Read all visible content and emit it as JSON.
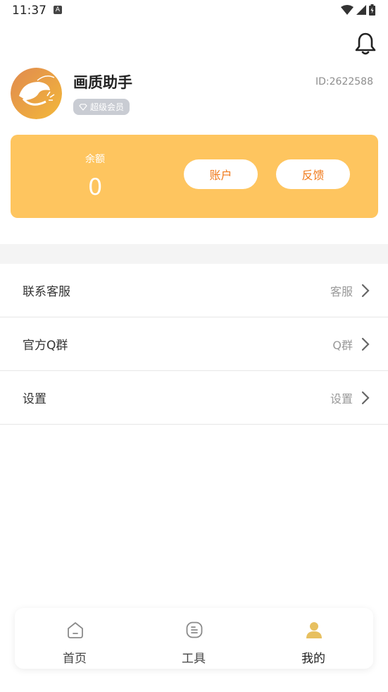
{
  "status_bar": {
    "time": "11:37",
    "a_icon": "A"
  },
  "header": {
    "bell_icon": "bell-icon"
  },
  "profile": {
    "name": "画质助手",
    "badge": "超级会员",
    "id": "ID:2622588"
  },
  "balance_card": {
    "label": "余额",
    "value": "0",
    "account_button": "账户",
    "feedback_button": "反馈"
  },
  "menu": [
    {
      "label": "联系客服",
      "value": "客服"
    },
    {
      "label": "官方Q群",
      "value": "Q群"
    },
    {
      "label": "设置",
      "value": "设置"
    }
  ],
  "tabbar": {
    "home": "首页",
    "tools": "工具",
    "mine": "我的"
  },
  "colors": {
    "card": "#fec55f",
    "button_text": "#f07a1b",
    "active_tab_icon": "#e7c060",
    "badge": "#c9ccd3"
  }
}
